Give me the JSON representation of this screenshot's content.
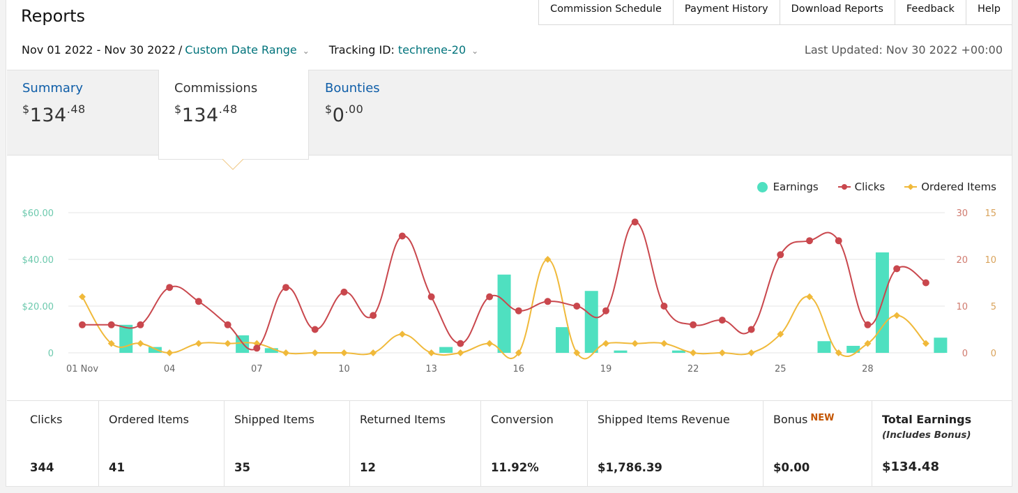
{
  "header": {
    "title": "Reports",
    "nav": [
      "Commission Schedule",
      "Payment History",
      "Download Reports",
      "Feedback",
      "Help"
    ]
  },
  "filters": {
    "date_range": "Nov 01 2022 - Nov 30 2022",
    "separator": "/",
    "range_type": "Custom Date Range",
    "tracking_label": "Tracking ID:",
    "tracking_id": "techrene-20",
    "last_updated": "Last Updated: Nov 30 2022 +00:00"
  },
  "tabs": [
    {
      "label": "Summary",
      "currency": "$",
      "dollars": "134",
      "cents": ".48",
      "active": false
    },
    {
      "label": "Commissions",
      "currency": "$",
      "dollars": "134",
      "cents": ".48",
      "active": true
    },
    {
      "label": "Bounties",
      "currency": "$",
      "dollars": "0",
      "cents": ".00",
      "active": false
    }
  ],
  "legend": {
    "earnings": "Earnings",
    "clicks": "Clicks",
    "ordered_items": "Ordered Items"
  },
  "colors": {
    "earnings": "#4fe0c0",
    "clicks": "#c9474d",
    "ordered_items": "#f0b93a",
    "link": "#00737b",
    "tab_link": "#0f5ea8",
    "new_badge": "#c45500"
  },
  "chart_data": {
    "type": "bar",
    "x": [
      1,
      2,
      3,
      4,
      5,
      6,
      7,
      8,
      9,
      10,
      11,
      12,
      13,
      14,
      15,
      16,
      17,
      18,
      19,
      20,
      21,
      22,
      23,
      24,
      25,
      26,
      27,
      28,
      29,
      30
    ],
    "x_tick_labels": [
      "01 Nov",
      "04",
      "07",
      "10",
      "13",
      "16",
      "19",
      "22",
      "25",
      "28"
    ],
    "x_tick_days": [
      1,
      4,
      7,
      10,
      13,
      16,
      19,
      22,
      25,
      28
    ],
    "series": [
      {
        "name": "Earnings",
        "type": "bar",
        "axis": "left",
        "values": [
          0,
          12,
          2.5,
          0,
          0,
          7.5,
          2,
          0,
          0,
          0,
          0,
          0,
          2.5,
          0,
          33.5,
          0,
          11,
          26.5,
          1,
          0,
          1,
          0,
          0,
          0,
          0,
          5,
          3,
          43,
          0,
          6.5
        ]
      },
      {
        "name": "Clicks",
        "type": "line",
        "axis": "right-clicks",
        "values": [
          6,
          6,
          6,
          14,
          11,
          6,
          1,
          14,
          5,
          13,
          8,
          25,
          12,
          2,
          12,
          9,
          11,
          10,
          9,
          28,
          10,
          6,
          7,
          5,
          21,
          24,
          24,
          6,
          18,
          15
        ]
      },
      {
        "name": "Ordered Items",
        "type": "line",
        "axis": "right-items",
        "values": [
          6,
          1,
          1,
          0,
          1,
          1,
          1,
          0,
          0,
          0,
          0,
          2,
          0,
          0,
          1,
          0,
          10,
          0,
          1,
          1,
          1,
          0,
          0,
          0,
          2,
          6,
          0,
          1,
          4,
          1
        ]
      }
    ],
    "y_left": {
      "ticks": [
        "$60.00",
        "$40.00",
        "$20.00",
        "0"
      ],
      "range": [
        0,
        60
      ]
    },
    "y_right_clicks": {
      "ticks": [
        "30",
        "20",
        "10",
        "0"
      ],
      "range": [
        0,
        30
      ]
    },
    "y_right_items": {
      "ticks": [
        "15",
        "10",
        "5",
        "0"
      ],
      "range": [
        0,
        15
      ]
    },
    "grid": true,
    "legend_position": "top-right"
  },
  "stats": [
    {
      "label": "Clicks",
      "value": "344"
    },
    {
      "label": "Ordered Items",
      "value": "41"
    },
    {
      "label": "Shipped Items",
      "value": "35"
    },
    {
      "label": "Returned Items",
      "value": "12"
    },
    {
      "label": "Conversion",
      "value": "11.92%"
    },
    {
      "label": "Shipped Items Revenue",
      "value": "$1,786.39"
    },
    {
      "label": "Bonus",
      "badge": "NEW",
      "value": "$0.00"
    },
    {
      "label": "Total Earnings",
      "sub": "(Includes Bonus)",
      "value": "$134.48"
    }
  ]
}
